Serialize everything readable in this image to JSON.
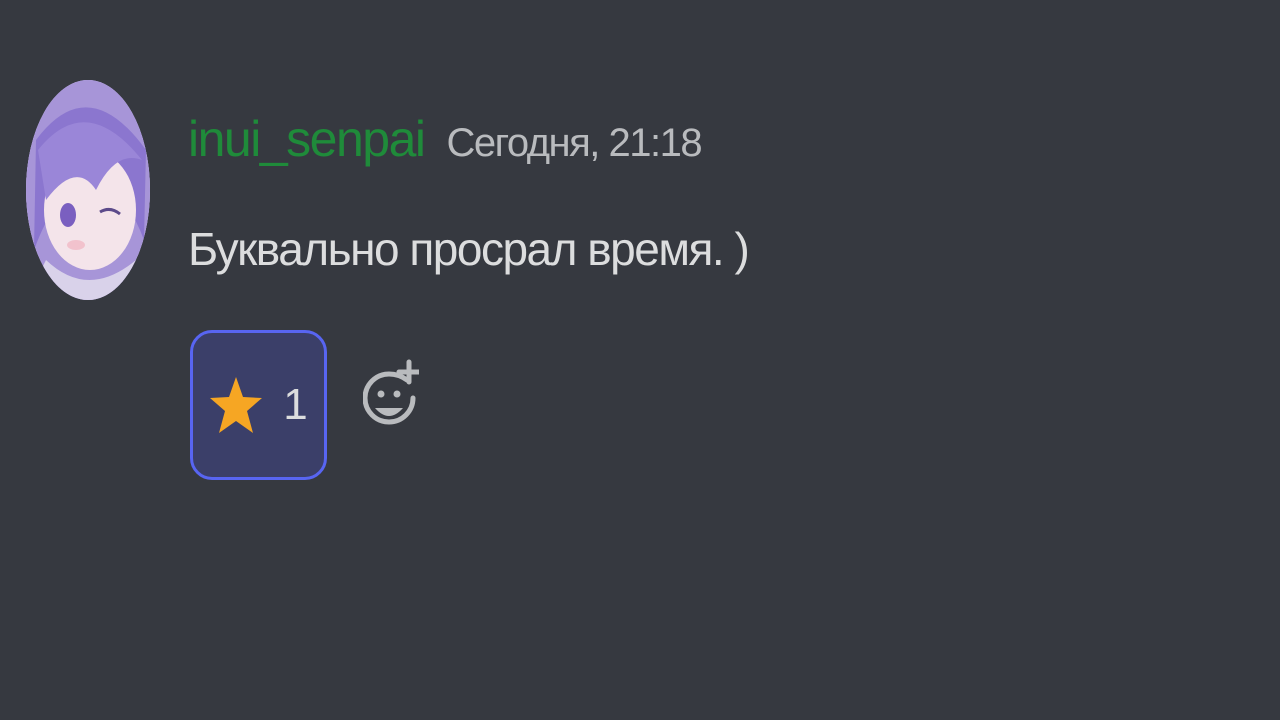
{
  "message": {
    "username": "inui_senpai",
    "timestamp": "Сегодня, 21:18",
    "text": "Буквально просрал время. )"
  },
  "reactions": [
    {
      "emoji_icon": "star-icon",
      "count": "1",
      "active": true
    }
  ],
  "add_reaction_icon": "add-reaction-icon",
  "avatar_icon": "anime-girl-avatar",
  "colors": {
    "background": "#363940",
    "username": "#1f8b3a",
    "timestamp": "#b9bbbe",
    "text": "#dcddde",
    "reaction_bg": "#3b3f69",
    "reaction_border": "#5865f2",
    "star": "#f6a623",
    "icon": "#b9bbbe"
  }
}
